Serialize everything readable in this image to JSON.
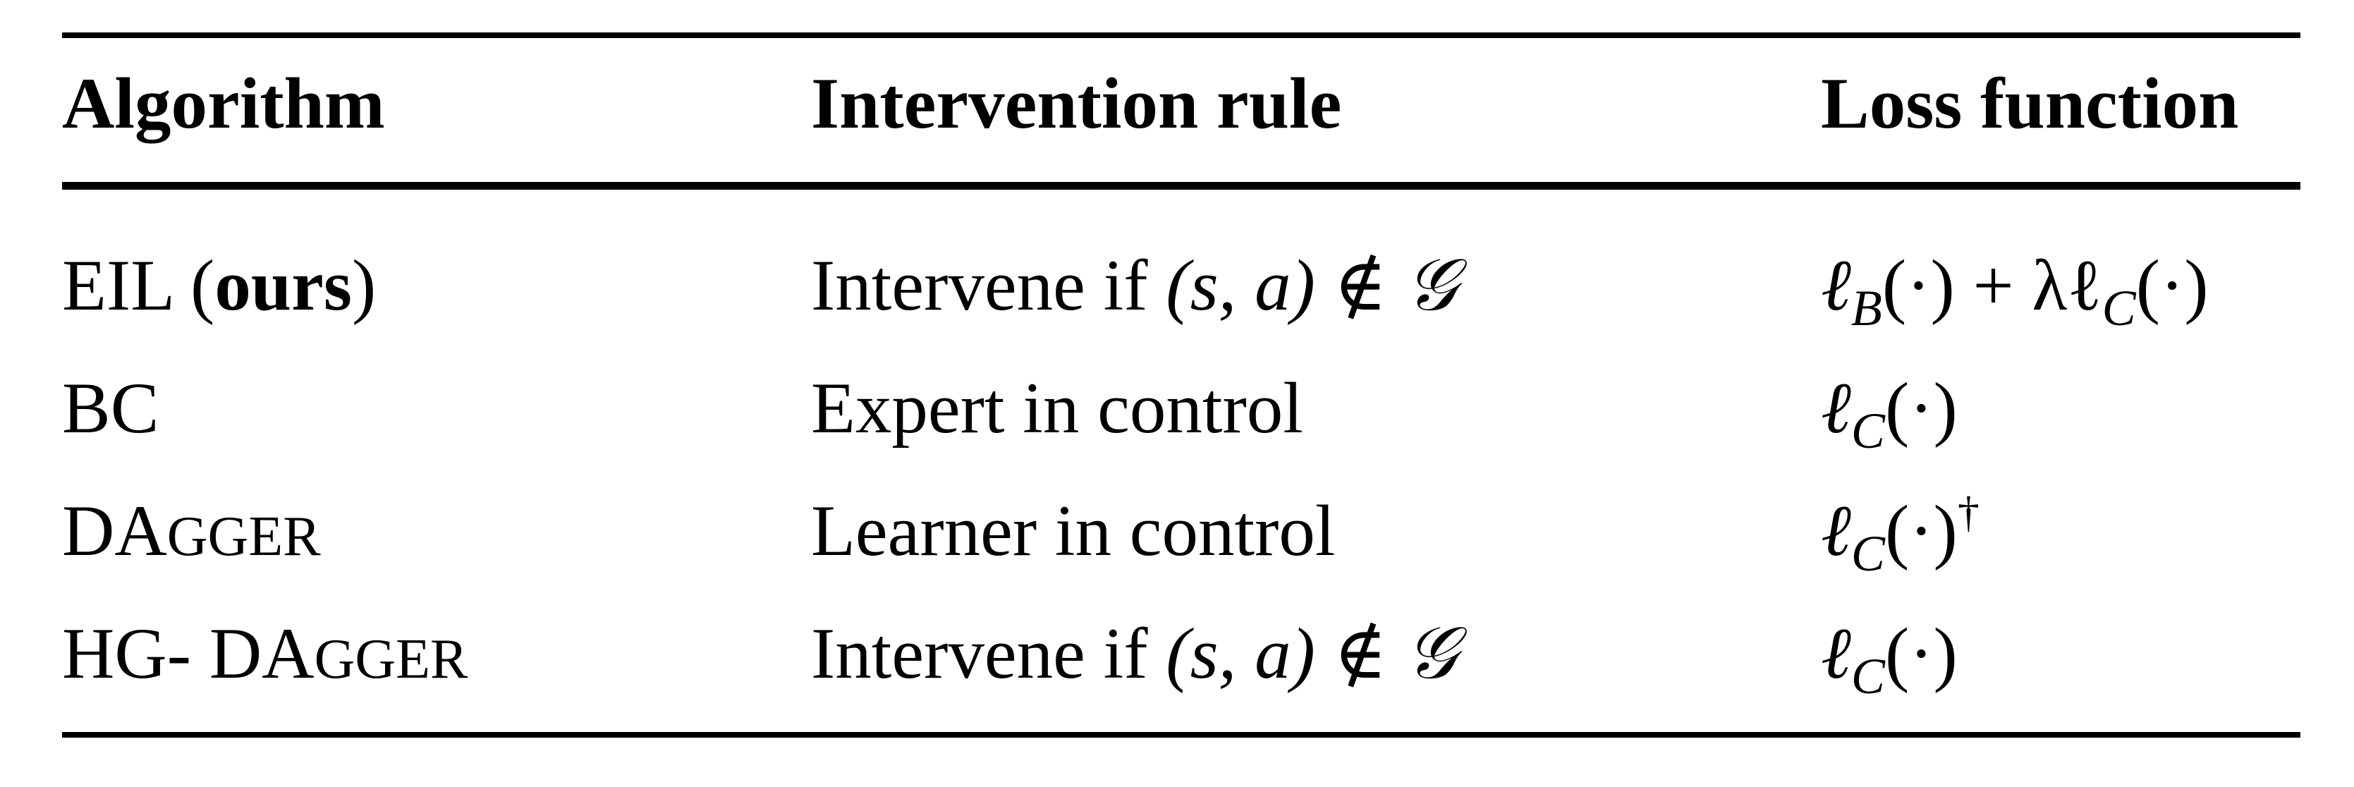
{
  "table": {
    "headers": {
      "algorithm": "Algorithm",
      "intervention": "Intervention rule",
      "loss": "Loss function"
    },
    "rows": [
      {
        "algorithm_prefix": "EIL (",
        "algorithm_bold": "ours",
        "algorithm_suffix": ")",
        "intervention_text": "Intervene if ",
        "intervention_math": "(s, a) ∉ 𝒢",
        "loss_parts": [
          "ℓ",
          "B",
          "(·) + λℓ",
          "C",
          "(·)"
        ]
      },
      {
        "algorithm": "BC",
        "intervention_text": "Expert in control",
        "loss_parts": [
          "ℓ",
          "C",
          "(·)"
        ]
      },
      {
        "algorithm_cap1": "DA",
        "algorithm_small": "GGER",
        "intervention_text": "Learner in control",
        "loss_parts": [
          "ℓ",
          "C",
          "(·)",
          "†"
        ]
      },
      {
        "algorithm_prefix": "HG- ",
        "algorithm_cap1": "DA",
        "algorithm_small": "GGER",
        "intervention_text": "Intervene if ",
        "intervention_math": "(s, a) ∉ 𝒢",
        "loss_parts": [
          "ℓ",
          "C",
          "(·)"
        ]
      }
    ]
  }
}
